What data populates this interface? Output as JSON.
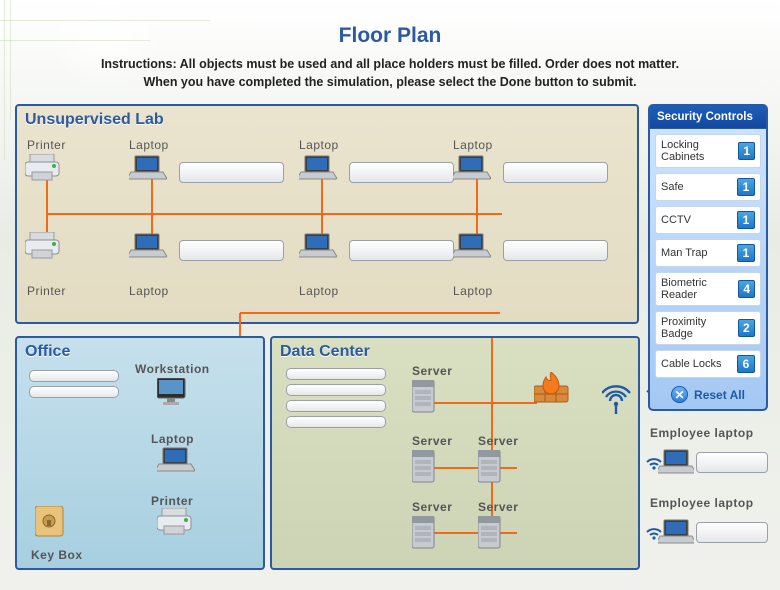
{
  "title": "Floor Plan",
  "instructions_line1": "Instructions: All objects must be used and all place holders must be filled. Order does not matter.",
  "instructions_line2": "When you have completed the simulation, please select the Done button to submit.",
  "panels": {
    "lab": "Unsupervised Lab",
    "office": "Office",
    "datacenter": "Data Center"
  },
  "labels": {
    "printer": "Printer",
    "laptop": "Laptop",
    "workstation": "Workstation",
    "server": "Server",
    "keybox": "Key Box",
    "employee_laptop": "Employee laptop"
  },
  "sidebar": {
    "header": "Security Controls",
    "items": [
      {
        "label": "Locking Cabinets",
        "count": 1
      },
      {
        "label": "Safe",
        "count": 1
      },
      {
        "label": "CCTV",
        "count": 1
      },
      {
        "label": "Man Trap",
        "count": 1
      },
      {
        "label": "Biometric Reader",
        "count": 4
      },
      {
        "label": "Proximity Badge",
        "count": 2
      },
      {
        "label": "Cable Locks",
        "count": 6
      }
    ],
    "reset": "Reset  All"
  }
}
